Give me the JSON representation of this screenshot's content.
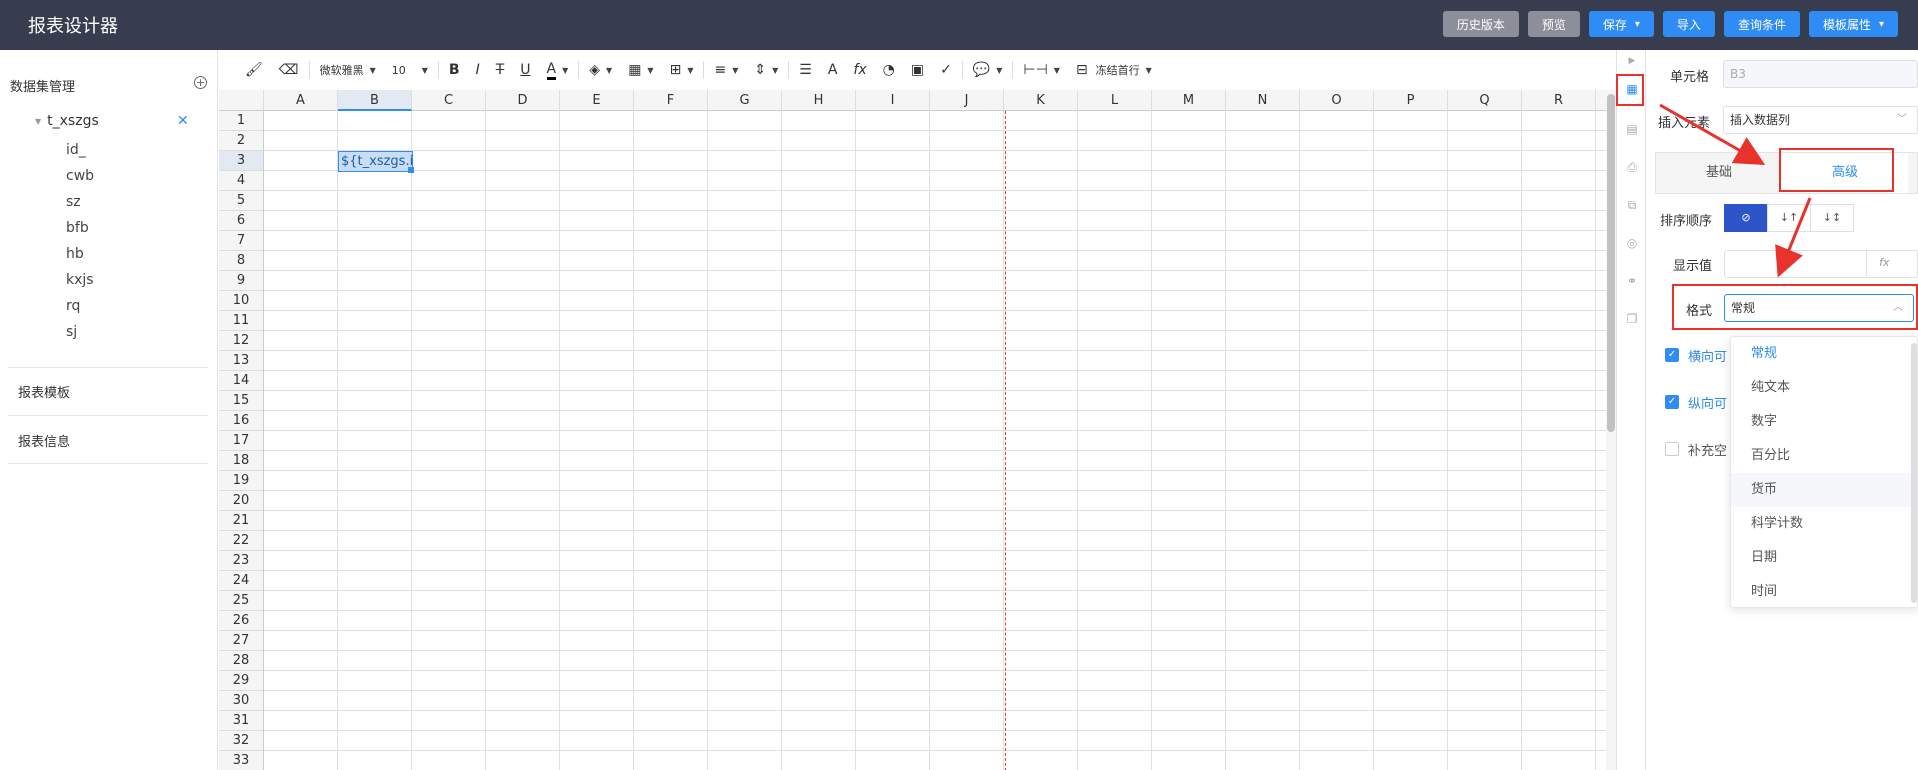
{
  "app": {
    "title": "报表设计器"
  },
  "header_buttons": {
    "history": "历史版本",
    "preview": "预览",
    "save": "保存",
    "import": "导入",
    "query": "查询条件",
    "template": "模板属性"
  },
  "sidebar": {
    "dataset_title": "数据集管理",
    "dataset_name": "t_xszgs",
    "fields": [
      "id_",
      "cwb",
      "sz",
      "bfb",
      "hb",
      "kxjs",
      "rq",
      "sj"
    ],
    "template_title": "报表模板",
    "info_title": "报表信息"
  },
  "toolbar": {
    "font_name": "微软雅黑",
    "font_size": "10",
    "freeze": "冻结首行"
  },
  "sheet": {
    "columns": [
      "A",
      "B",
      "C",
      "D",
      "E",
      "F",
      "G",
      "H",
      "I",
      "J",
      "K",
      "L",
      "M",
      "N",
      "O",
      "P",
      "Q",
      "R"
    ],
    "rows": [
      "1",
      "2",
      "3",
      "4",
      "5",
      "6",
      "7",
      "8",
      "9",
      "10",
      "11",
      "12",
      "13",
      "14",
      "15",
      "16",
      "17",
      "18",
      "19",
      "20",
      "21",
      "22",
      "23",
      "24",
      "25",
      "26",
      "27",
      "28",
      "29",
      "30",
      "31",
      "32",
      "33"
    ],
    "selected_cell_text": "${t_xszgs.id_}",
    "selected_column": "B",
    "selected_row": "3"
  },
  "panel": {
    "cell_label": "单元格",
    "cell_value": "B3",
    "insert_label": "插入元素",
    "insert_value": "插入数据列",
    "tab_basic": "基础",
    "tab_advanced": "高级",
    "sort_label": "排序顺序",
    "sort_options": [
      "⊘",
      "↓↑",
      "↓↕"
    ],
    "display_label": "显示值",
    "display_fx": "fx",
    "format_label": "格式",
    "format_value": "常规",
    "chk_horizontal": "横向可",
    "chk_vertical": "纵向可",
    "chk_fill": "补充空"
  },
  "format_options": [
    "常规",
    "纯文本",
    "数字",
    "百分比",
    "货币",
    "科学计数",
    "日期",
    "时间"
  ],
  "colors": {
    "accent": "#2f8cf5",
    "topbar": "#383c4f",
    "highlight": "#e8322b"
  }
}
